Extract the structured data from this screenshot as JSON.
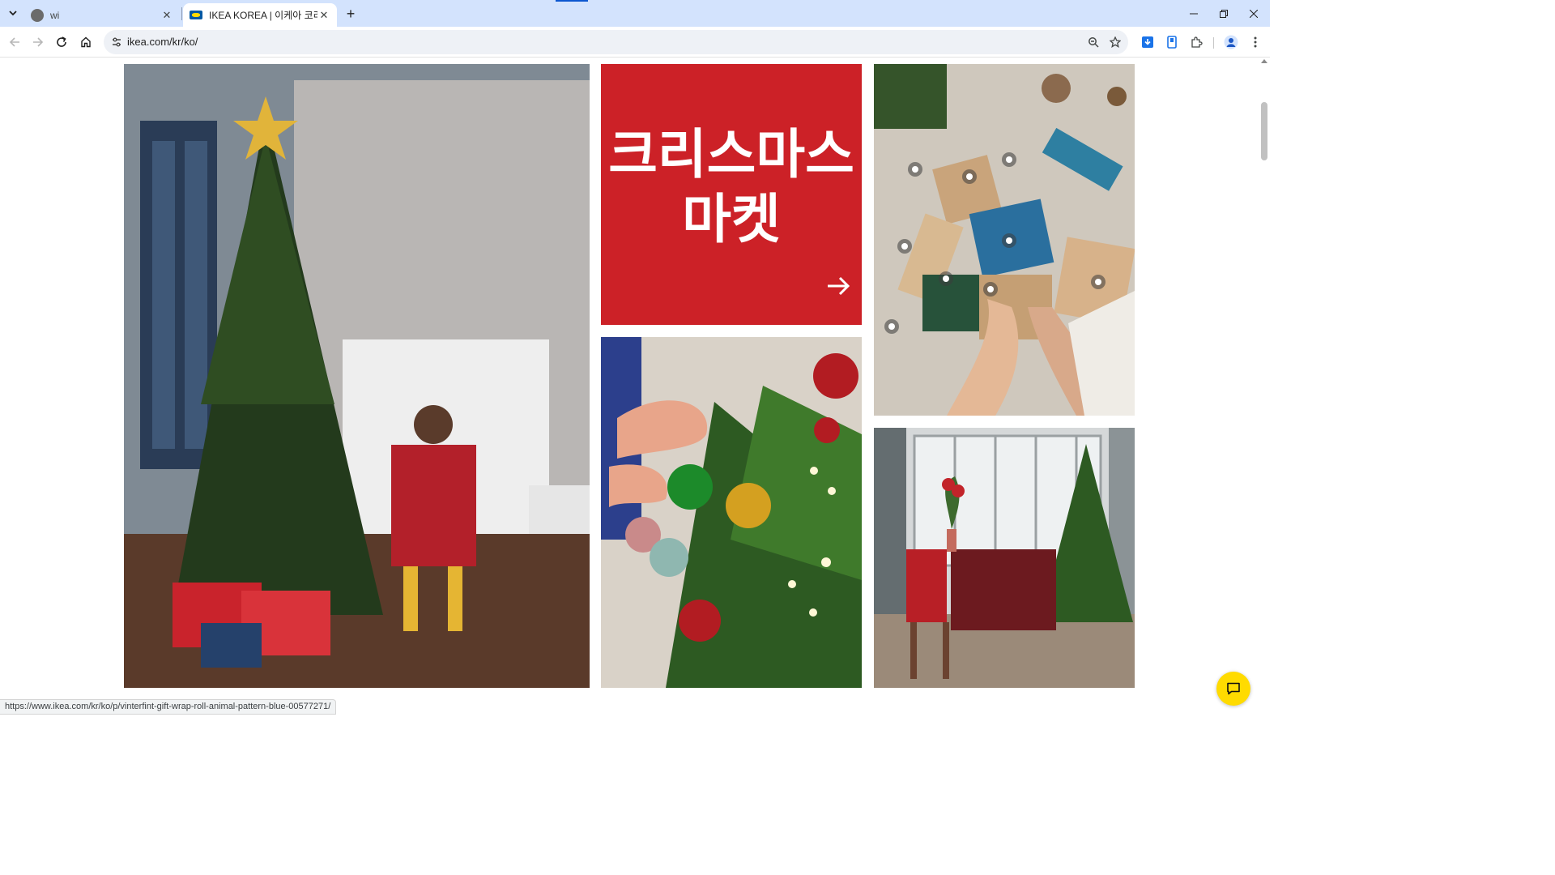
{
  "browser": {
    "tabs": [
      {
        "title": "wi",
        "active": false
      },
      {
        "title": "IKEA KOREA | 이케아 코리아 -",
        "active": true
      }
    ],
    "new_tab_symbol": "+",
    "address": "ikea.com/kr/ko/",
    "status_url": "https://www.ikea.com/kr/ko/p/vinterfint-gift-wrap-roll-animal-pattern-blue-00577271/"
  },
  "page": {
    "promo": {
      "title_line1": "크리스마스",
      "title_line2": "마켓",
      "color": "#cc2127"
    },
    "images": [
      {
        "name": "christmas-tree-living-room"
      },
      {
        "name": "ornaments-on-tree"
      },
      {
        "name": "gift-wrapping-table"
      },
      {
        "name": "christmas-dining-room"
      }
    ]
  },
  "icons": {
    "tab_search": "chevron-down-icon",
    "back": "arrow-left-icon",
    "forward": "arrow-right-icon",
    "reload": "reload-icon",
    "home": "home-icon",
    "zoom": "zoom-icon",
    "bookmark": "star-icon",
    "chat": "chat-bubble-icon"
  },
  "colors": {
    "tabstrip": "#d3e3fd",
    "ikea_yellow": "#ffdb00",
    "ikea_blue": "#0058a3"
  }
}
